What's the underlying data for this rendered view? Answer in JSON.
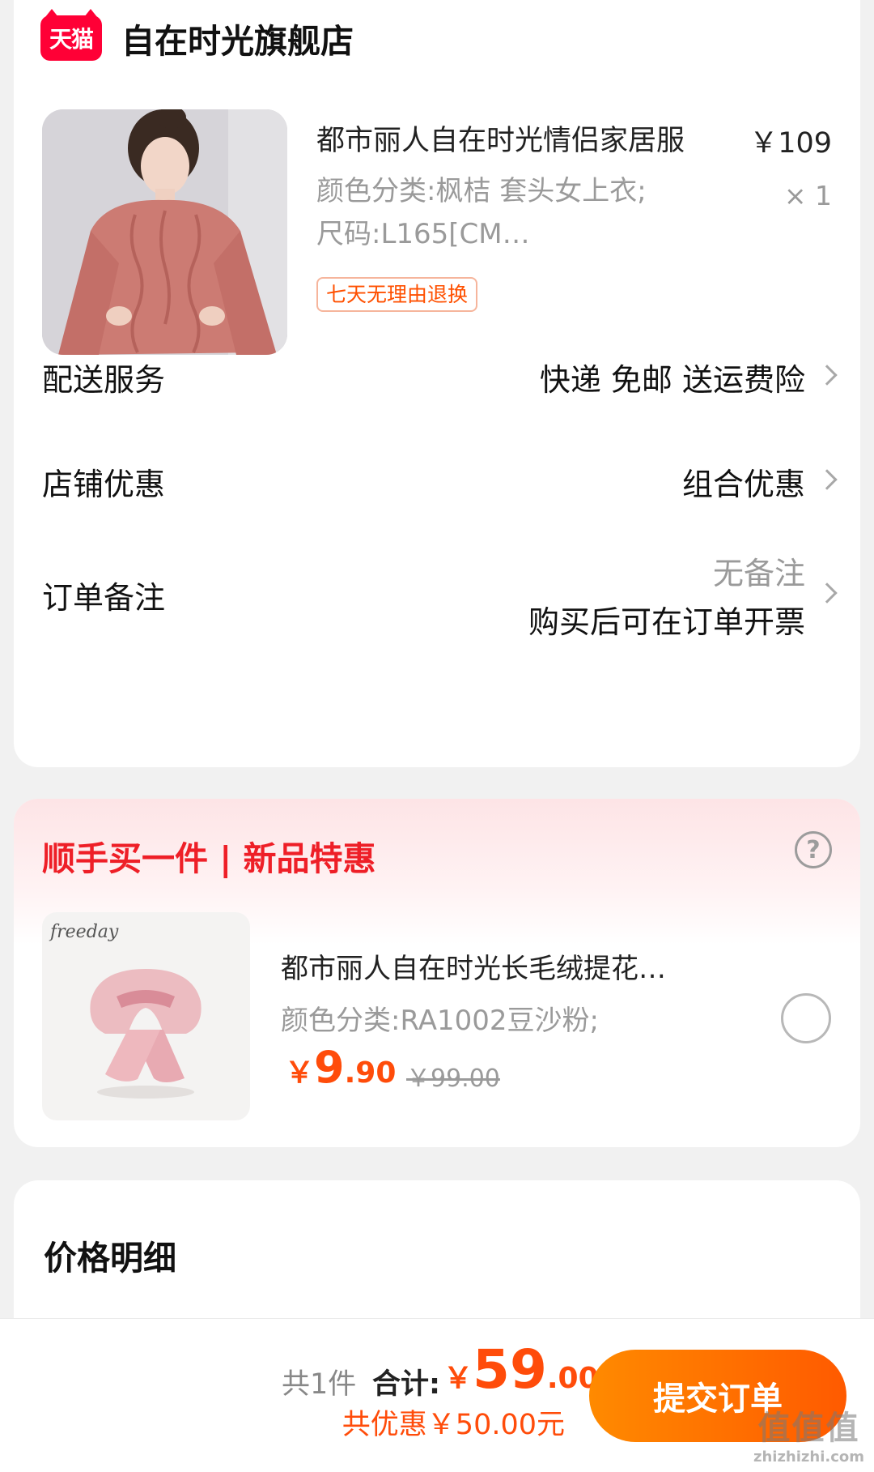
{
  "store": {
    "badge": "天猫",
    "name": "自在时光旗舰店"
  },
  "product": {
    "title": "都市丽人自在时光情侣家居服",
    "price": "￥109",
    "sku": "颜色分类:枫桔 套头女上衣;尺码:L165[CM…",
    "qty": "× 1",
    "return_tag": "七天无理由退换"
  },
  "rows": {
    "delivery": {
      "label": "配送服务",
      "value": "快递 免邮 送运费险"
    },
    "discount": {
      "label": "店铺优惠",
      "value": "组合优惠"
    },
    "note": {
      "label": "订单备注",
      "value_line1": "无备注",
      "value_line2": "购买后可在订单开票"
    }
  },
  "addon": {
    "title": "顺手买一件 | 新品特惠",
    "help": "?",
    "brand": "freeday",
    "name": "都市丽人自在时光长毛绒提花…",
    "sku": "颜色分类:RA1002豆沙粉;",
    "price_currency": "￥",
    "price_int": "9",
    "price_dec": ".90",
    "orig_price": "￥99.00"
  },
  "price_detail": {
    "title": "价格明细"
  },
  "bottom": {
    "count": "共1件",
    "total_label": "合计:",
    "total_currency": "￥",
    "total_int": "59",
    "total_dec": ".00",
    "discount": "共优惠￥50.00元",
    "submit": "提交订单"
  },
  "watermark": {
    "main": "值值值",
    "sub": "zhizhizhi.com"
  },
  "colors": {
    "brand_red": "#ff0036",
    "accent_orange": "#ff4c0a",
    "addon_title_red": "#ee1f27",
    "button_gradient_start": "#ff8a00",
    "button_gradient_end": "#ff5a00"
  }
}
